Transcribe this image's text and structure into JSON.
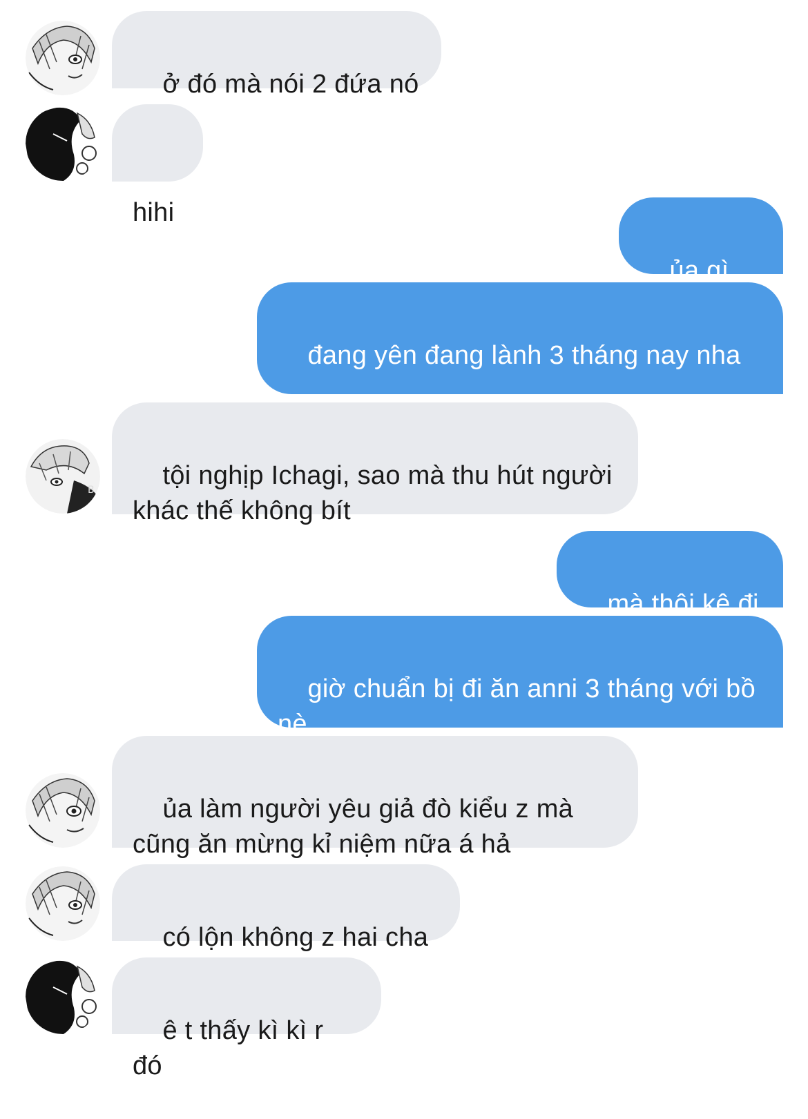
{
  "conversation": {
    "messages": [
      {
        "side": "incoming",
        "avatar": "character-a-avatar",
        "text": "ở đó mà nói 2 đứa nó"
      },
      {
        "side": "incoming",
        "avatar": "character-b-avatar",
        "text": "hihi"
      },
      {
        "side": "outgoing",
        "text": "ủa gì vậy"
      },
      {
        "side": "outgoing",
        "text": "đang yên đang lành 3 tháng nay nha"
      },
      {
        "side": "incoming",
        "avatar": "character-c-avatar",
        "text": "tội nghịp Ichagi, sao mà thu hút người khác thế không bít"
      },
      {
        "side": "outgoing",
        "text": "mà thôi kệ đi"
      },
      {
        "side": "outgoing",
        "text": "giờ chuẩn bị đi ăn anni 3 tháng với bồ nè"
      },
      {
        "side": "incoming",
        "avatar": "character-a-avatar",
        "text": "ủa làm người yêu giả đò kiểu z mà cũng ăn mừng kỉ niệm nữa á hả"
      },
      {
        "side": "incoming",
        "avatar": "character-a-avatar",
        "text": "có lộn không z hai cha"
      },
      {
        "side": "incoming",
        "avatar": "character-b-avatar",
        "text": "ê t thấy kì kì r đó"
      }
    ]
  },
  "colors": {
    "incoming_bubble": "#e8eaee",
    "outgoing_bubble": "#4d9be6",
    "incoming_text": "#1a1a1a",
    "outgoing_text": "#ffffff"
  }
}
